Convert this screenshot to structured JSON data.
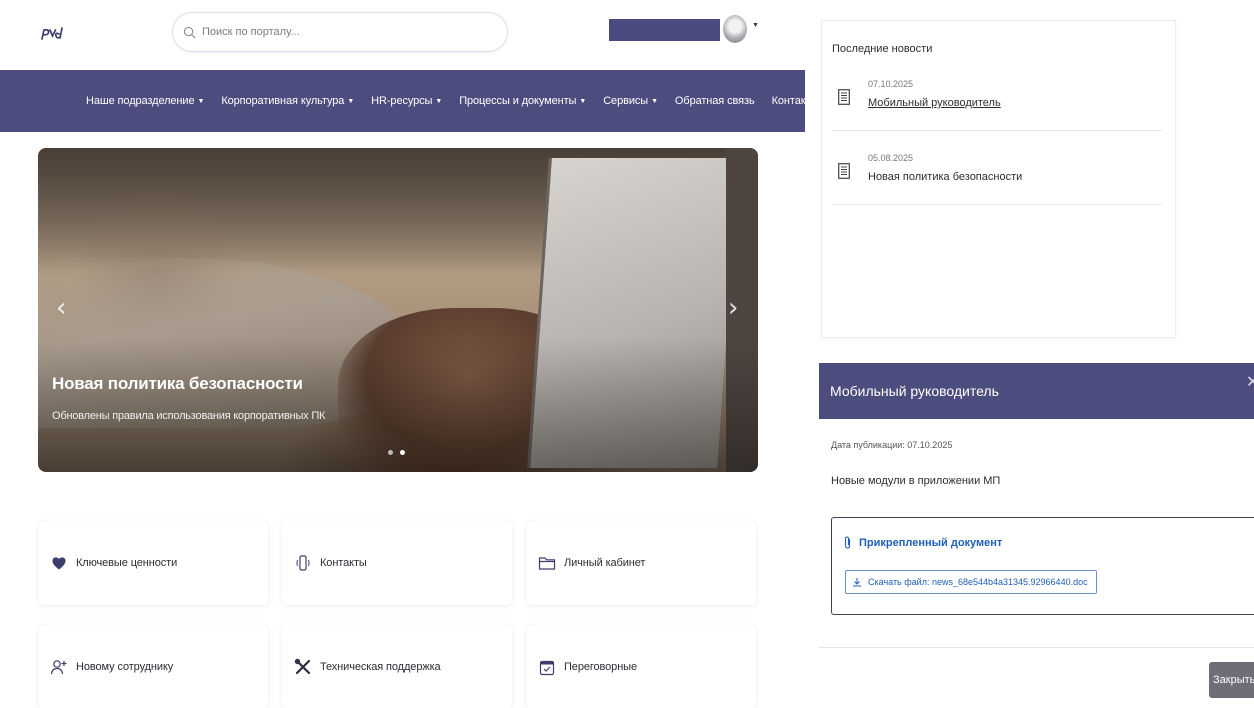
{
  "header": {
    "search_placeholder": "Поиск по порталу..."
  },
  "nav": {
    "items": [
      {
        "label": "Наше подразделение",
        "dropdown": true
      },
      {
        "label": "Корпоративная культура",
        "dropdown": true
      },
      {
        "label": "HR-ресурсы",
        "dropdown": true
      },
      {
        "label": "Процессы и документы",
        "dropdown": true
      },
      {
        "label": "Сервисы",
        "dropdown": true
      },
      {
        "label": "Обратная связь",
        "dropdown": false
      },
      {
        "label": "Контакты",
        "dropdown": true
      }
    ]
  },
  "hero": {
    "title": "Новая политика безопасности",
    "subtitle": "Обновлены правила использования корпоративных ПК",
    "prev_icon": "‹",
    "next_icon": "›",
    "slide_count": 2,
    "active_slide": 1
  },
  "cards": [
    {
      "label": "Ключевые ценности",
      "icon": "heart-icon"
    },
    {
      "label": "Контакты",
      "icon": "phone-icon"
    },
    {
      "label": "Личный кабинет",
      "icon": "folder-icon"
    },
    {
      "label": "Новому сотруднику",
      "icon": "add-user-icon"
    },
    {
      "label": "Техническая поддержка",
      "icon": "tools-icon"
    },
    {
      "label": "Переговорные",
      "icon": "calendar-check-icon"
    }
  ],
  "news": {
    "title": "Последние новости",
    "items": [
      {
        "date": "07.10.2025",
        "title": "Мобильный руководитель"
      },
      {
        "date": "05.08.2025",
        "title": "Новая политика безопасности"
      }
    ]
  },
  "modal": {
    "title": "Мобильный руководитель",
    "close_icon": "✕",
    "publication_date": "Дата публикации: 07.10.2025",
    "description": "Новые модули в приложении МП",
    "attachment_title": "Прикрепленный документ",
    "download_label": "Скачать файл: news_68e544b4a31345.92966440.doc",
    "close_button": "Закрыть"
  },
  "colors": {
    "primary": "#4c4c7e",
    "link": "#1f5fb8"
  }
}
